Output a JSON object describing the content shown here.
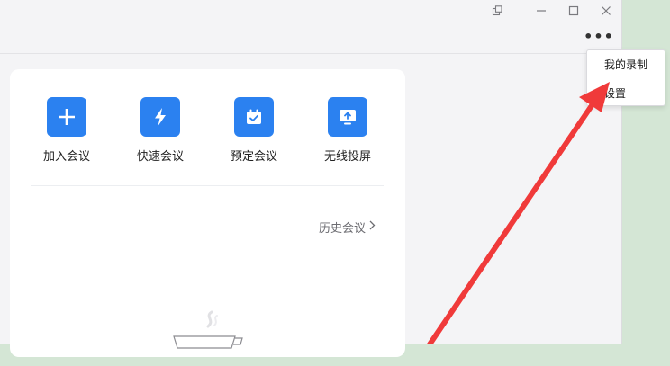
{
  "title_bar": {
    "icons": [
      "pin-window-icon",
      "minimize-icon",
      "maximize-icon",
      "close-icon"
    ]
  },
  "toolbar": {
    "more_label": "•••"
  },
  "actions": [
    {
      "label": "加入会议",
      "icon": "plus-icon"
    },
    {
      "label": "快速会议",
      "icon": "lightning-icon"
    },
    {
      "label": "预定会议",
      "icon": "calendar-check-icon"
    },
    {
      "label": "无线投屏",
      "icon": "screen-cast-icon"
    }
  ],
  "history": {
    "label": "历史会议",
    "chevron": "›"
  },
  "menu": {
    "items": [
      "我的录制",
      "设置"
    ]
  },
  "colors": {
    "accent": "#2b81f0",
    "annotation_arrow": "#f03a3a",
    "desktop": "#d4e6d5"
  }
}
